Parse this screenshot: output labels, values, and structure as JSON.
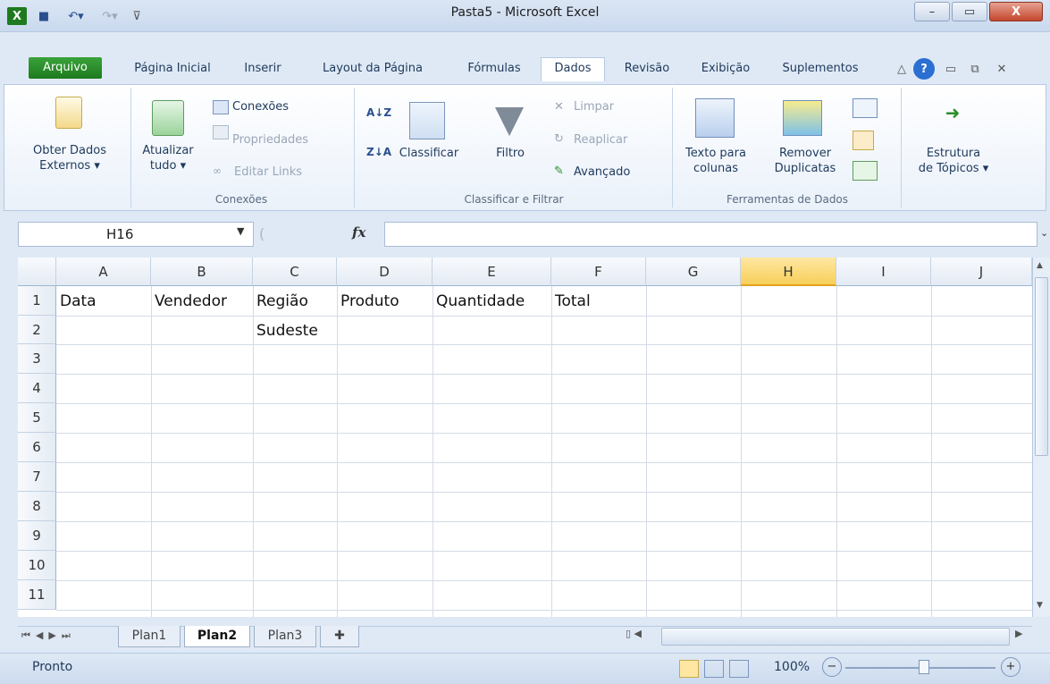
{
  "window": {
    "title": "Pasta5 - Microsoft Excel",
    "minimize": "–",
    "maximize": "▭",
    "close": "X"
  },
  "tabs": [
    {
      "label": "Arquivo"
    },
    {
      "label": "Página Inicial"
    },
    {
      "label": "Inserir"
    },
    {
      "label": "Layout da Página"
    },
    {
      "label": "Fórmulas"
    },
    {
      "label": "Dados"
    },
    {
      "label": "Revisão"
    },
    {
      "label": "Exibição"
    },
    {
      "label": "Suplementos"
    }
  ],
  "ribbon": {
    "get_external": {
      "line1": "Obter Dados",
      "line2": "Externos ▾"
    },
    "refresh": {
      "line1": "Atualizar",
      "line2": "tudo ▾"
    },
    "connections": "Conexões",
    "properties": "Propriedades",
    "edit_links": "Editar Links",
    "group_connections": "Conexões",
    "sort_az": "A↓Z",
    "sort_za": "Z↓A",
    "sort": "Classificar",
    "filter": "Filtro",
    "clear": "Limpar",
    "reapply": "Reaplicar",
    "advanced": "Avançado",
    "group_sort_filter": "Classificar e Filtrar",
    "text_to_columns": {
      "line1": "Texto para",
      "line2": "colunas"
    },
    "remove_dup": {
      "line1": "Remover",
      "line2": "Duplicatas"
    },
    "group_data_tools": "Ferramentas de Dados",
    "outline": {
      "line1": "Estrutura",
      "line2": "de Tópicos ▾"
    }
  },
  "formula_bar": {
    "name_box": "H16",
    "fx": "fx",
    "formula": ""
  },
  "grid": {
    "columns": [
      "A",
      "B",
      "C",
      "D",
      "E",
      "F",
      "G",
      "H",
      "I",
      "J"
    ],
    "selected_column": "H",
    "rows": [
      "1",
      "2",
      "3",
      "4",
      "5",
      "6",
      "7",
      "8",
      "9",
      "10",
      "11"
    ],
    "cells": {
      "A1": "Data",
      "B1": "Vendedor",
      "C1": "Região",
      "D1": "Produto",
      "E1": "Quantidade",
      "F1": "Total",
      "C2": "Sudeste"
    }
  },
  "sheets": [
    {
      "label": "Plan1"
    },
    {
      "label": "Plan2",
      "active": true
    },
    {
      "label": "Plan3"
    }
  ],
  "status": {
    "state": "Pronto",
    "zoom": "100%"
  },
  "colors": {
    "file_tab": "#2a8f2a",
    "selected_header": "#f7cf5a",
    "ribbon_border": "#b6c9e2"
  }
}
